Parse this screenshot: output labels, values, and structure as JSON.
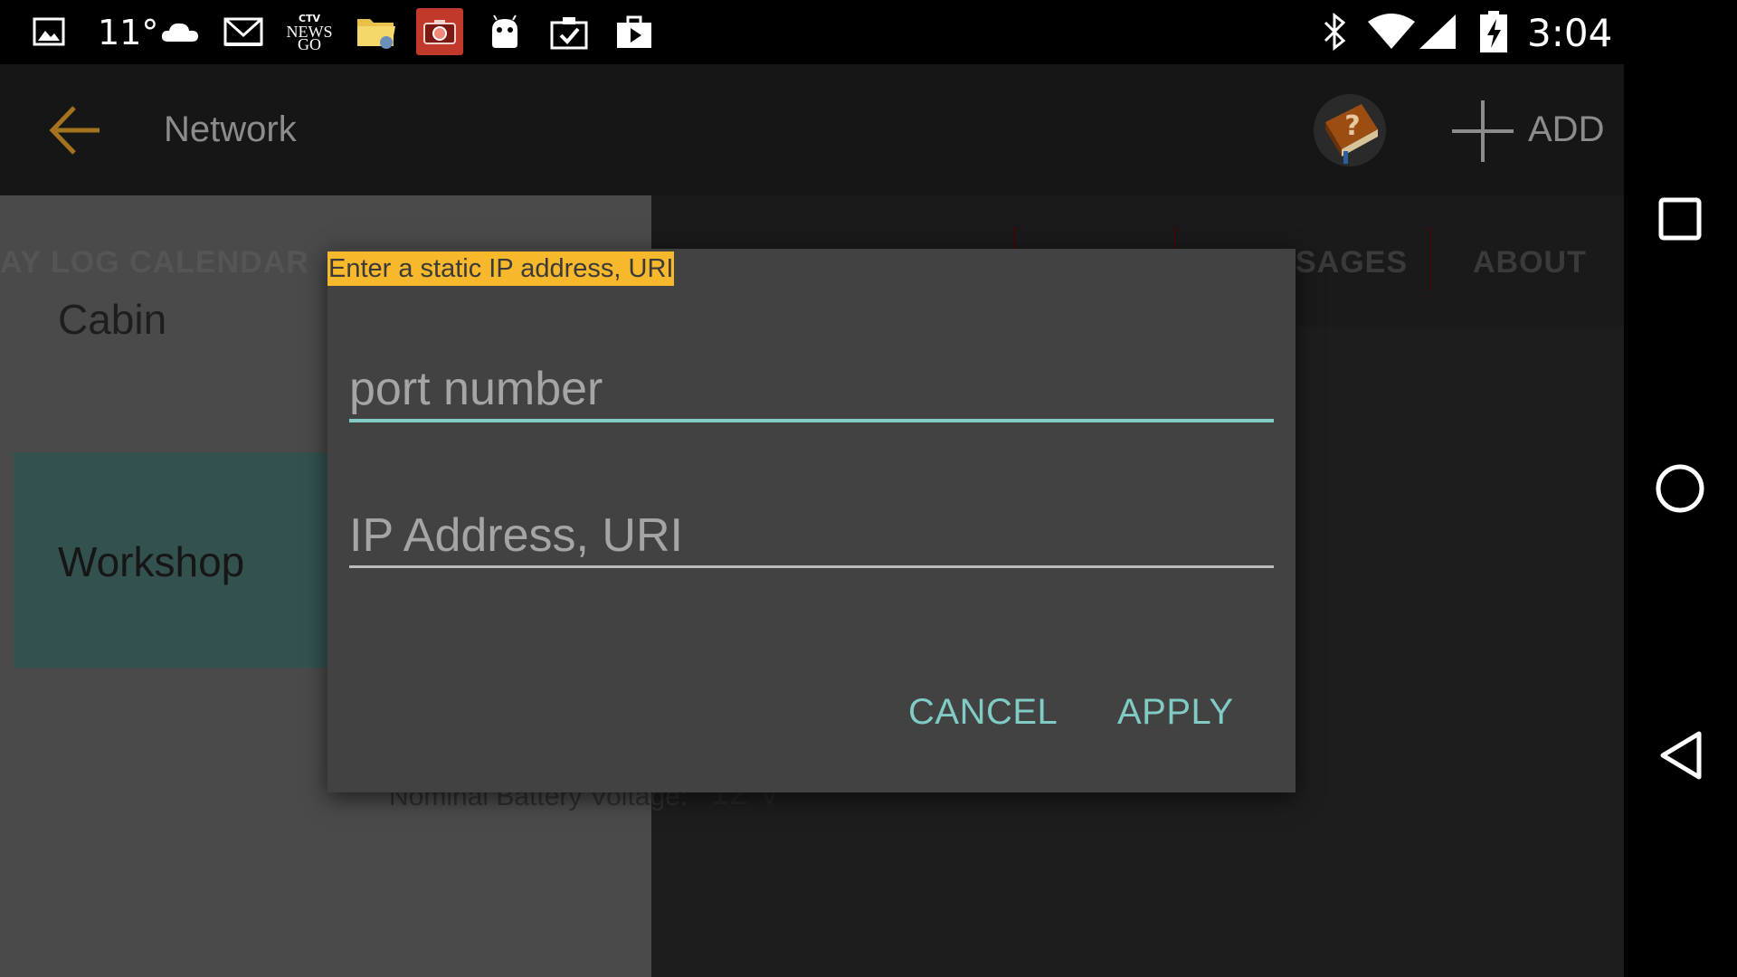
{
  "status_bar": {
    "temperature": "11°",
    "news_app_line1": "CTV",
    "news_app_line2": "NEWS",
    "news_app_line3": "GO",
    "time": "3:04",
    "icons": [
      "image-icon",
      "cloud-icon",
      "gmail-icon",
      "ctv-news-go-icon",
      "file-manager-icon",
      "camera-app-icon",
      "android-icon",
      "clipboard-check-icon",
      "play-store-icon",
      "bluetooth-icon",
      "wifi-icon",
      "signal-icon",
      "battery-charging-icon"
    ]
  },
  "app_bar": {
    "title": "Network",
    "add_label": "ADD",
    "icons": [
      "back-arrow-icon",
      "help-book-icon",
      "plus-icon"
    ]
  },
  "background": {
    "left_tabs_text": "AY LOG CALENDAR",
    "tabs": [
      "SAGES",
      "ABOUT"
    ],
    "items": [
      "Cabin",
      "Workshop"
    ],
    "voltage_label": "Nominal Battery Voltage:",
    "voltage_value": "12 V"
  },
  "dialog": {
    "title": "Enter a static IP address, URI",
    "port_placeholder": "port number",
    "port_value": "",
    "ip_placeholder": "IP Address, URI",
    "ip_value": "",
    "cancel_label": "CANCEL",
    "apply_label": "APPLY"
  },
  "nav_bar": {
    "icons": [
      "recents-square-icon",
      "home-circle-icon",
      "back-triangle-icon"
    ]
  },
  "colors": {
    "accent": "#80cbc4",
    "dialog_bg": "#424242",
    "title_highlight": "#f8b82b",
    "app_bar_bg": "#161616",
    "back_arrow": "#a5731e"
  }
}
